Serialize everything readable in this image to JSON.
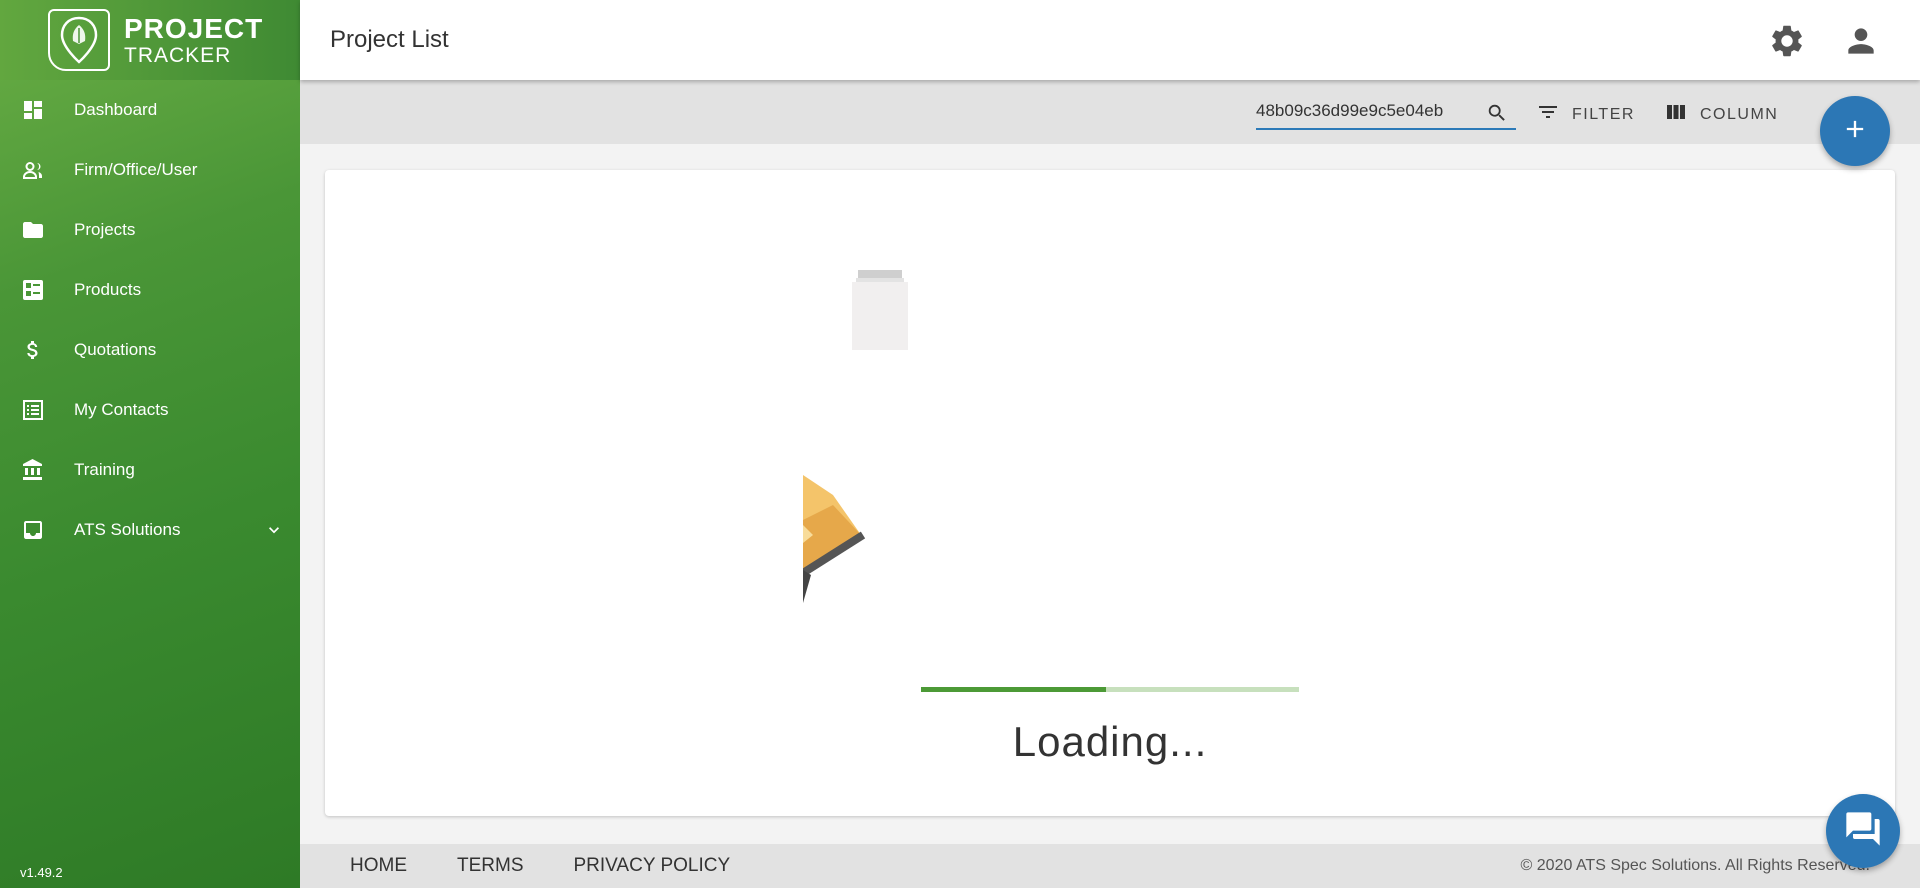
{
  "app": {
    "logo_line1": "PROJECT",
    "logo_line2": "TRACKER",
    "version": "v1.49.2"
  },
  "sidebar": {
    "items": [
      {
        "label": "Dashboard",
        "icon": "dashboard-icon"
      },
      {
        "label": "Firm/Office/User",
        "icon": "people-icon"
      },
      {
        "label": "Projects",
        "icon": "folder-icon"
      },
      {
        "label": "Products",
        "icon": "checklist-icon"
      },
      {
        "label": "Quotations",
        "icon": "dollar-icon"
      },
      {
        "label": "My Contacts",
        "icon": "list-icon"
      },
      {
        "label": "Training",
        "icon": "bank-icon"
      },
      {
        "label": "ATS Solutions",
        "icon": "inbox-icon",
        "expandable": true
      }
    ]
  },
  "header": {
    "title": "Project List",
    "settings_icon": "gear-icon",
    "profile_icon": "person-icon"
  },
  "toolbar": {
    "search_value": "48b09c36d99e9c5e04eb",
    "filter_label": "FILTER",
    "column_label": "COLUMN",
    "add_icon": "plus-icon"
  },
  "content": {
    "loading_text": "Loading...",
    "progress": 0.49
  },
  "footer": {
    "links": [
      "HOME",
      "TERMS",
      "PRIVACY POLICY"
    ],
    "copyright": "© 2020 ATS Spec Solutions. All Rights Reserved."
  },
  "colors": {
    "accent": "#2c77b5",
    "sidebar_green": "#4a9637",
    "progress_fill": "#4c9a36",
    "progress_track": "#c7e0bd"
  }
}
